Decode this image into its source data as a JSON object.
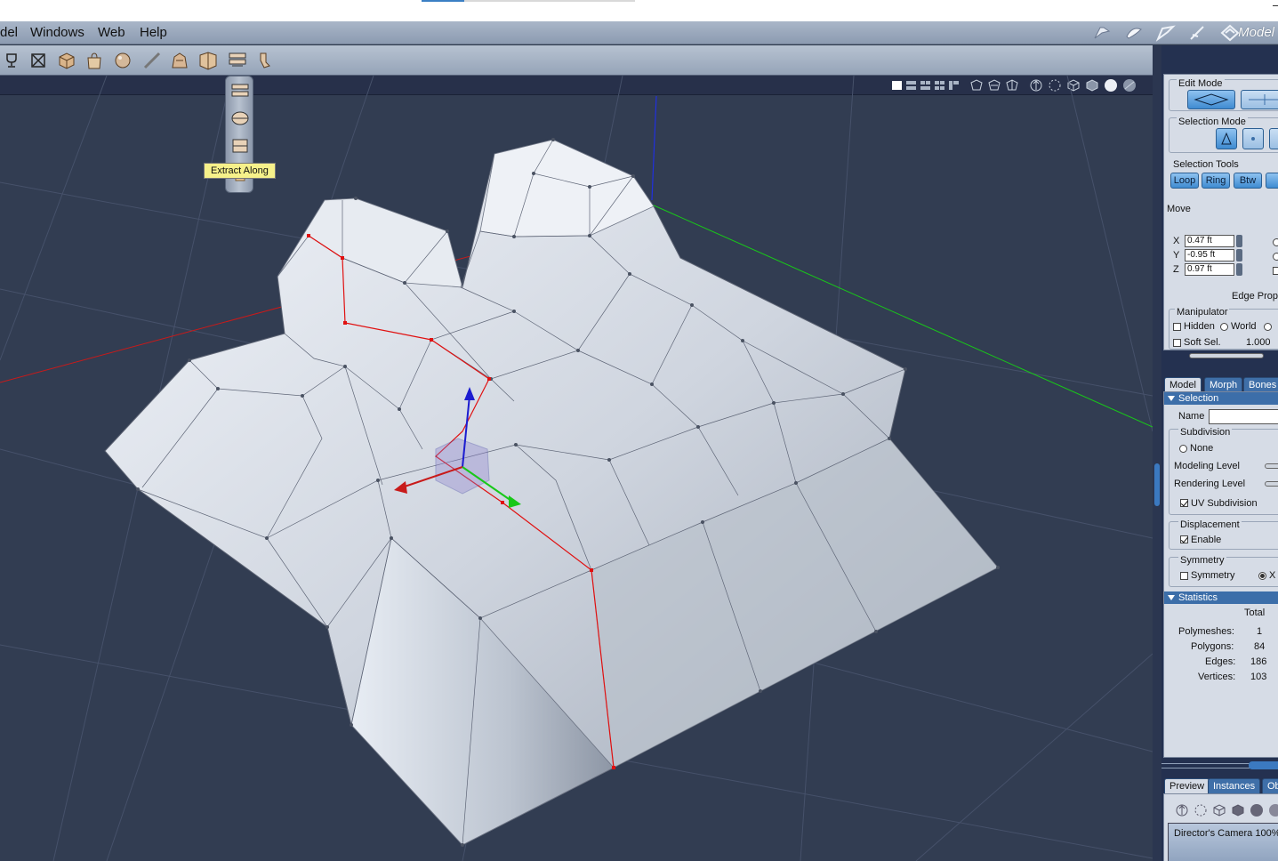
{
  "menubar": {
    "items": [
      "del",
      "Windows",
      "Web",
      "Help"
    ],
    "mode_label": "Model"
  },
  "toolbar": {
    "tools": [
      "tool-a-icon",
      "tool-b-icon",
      "box-icon",
      "bag-icon",
      "sphere-icon",
      "line-icon",
      "hand-icon",
      "extrude-icon",
      "extract-icon",
      "bend-icon"
    ]
  },
  "flyout": {
    "tooltip": "Extract Along"
  },
  "panel": {
    "edit_mode": "Edit Mode",
    "selection_mode": "Selection Mode",
    "selection_tools": "Selection Tools",
    "loop": "Loop",
    "ring": "Ring",
    "btw": "Btw",
    "move": "Move",
    "x_label": "X",
    "x_value": "0.47 ft",
    "y_label": "Y",
    "y_value": "-0.95 ft",
    "z_label": "Z",
    "z_value": "0.97 ft",
    "edge_props": "Edge Prop",
    "manipulator": "Manipulator",
    "hidden": "Hidden",
    "world": "World",
    "soft_sel": "Soft Sel.",
    "soft_sel_value": "1.000",
    "tabs": [
      "Model",
      "Morph",
      "Bones"
    ],
    "selection": "Selection",
    "name": "Name",
    "subdivision": "Subdivision",
    "none": "None",
    "modeling_level": "Modeling Level",
    "rendering_level": "Rendering Level",
    "uv_subdivision": "UV Subdivision",
    "displacement": "Displacement",
    "enable": "Enable",
    "symmetry_group": "Symmetry",
    "symmetry": "Symmetry",
    "sym_x": "X",
    "statistics": "Statistics",
    "total": "Total",
    "polymeshes_label": "Polymeshes:",
    "polymeshes": "1",
    "polygons_label": "Polygons:",
    "polygons": "84",
    "edges_label": "Edges:",
    "edges": "186",
    "vertices_label": "Vertices:",
    "vertices": "103",
    "bottom_tabs": [
      "Preview",
      "Instances",
      "Ob"
    ],
    "camera": "Director's Camera 100%"
  },
  "colors": {
    "accent": "#3f8bd1",
    "viewport_bg": "#323d52",
    "tooltip": "#f6f18a",
    "axis_x": "#d21818",
    "axis_y": "#18d218",
    "axis_z": "#1818d2",
    "selection": "#e01010"
  }
}
